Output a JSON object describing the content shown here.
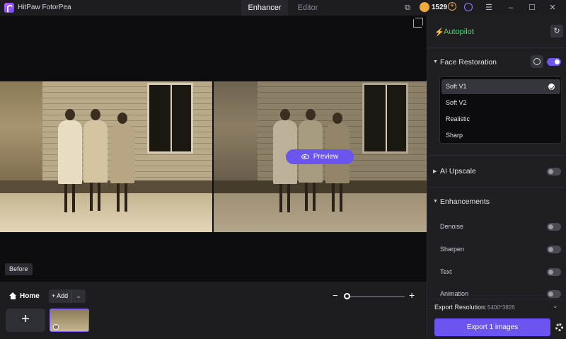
{
  "app": {
    "title": "HitPaw FotorPea"
  },
  "tabs": [
    {
      "label": "Enhancer",
      "active": true
    },
    {
      "label": "Editor",
      "active": false
    }
  ],
  "account": {
    "coins": "1529"
  },
  "canvas": {
    "before_label": "Before",
    "preview_label": "Preview"
  },
  "bottombar": {
    "home_label": "Home",
    "add_label": "+ Add",
    "add_tile_label": "+"
  },
  "panel": {
    "autopilot_label": "Autopilot",
    "face_restoration": {
      "title": "Face Restoration",
      "enabled": true,
      "models": [
        "Soft V1",
        "Soft V2",
        "Realistic",
        "Sharp"
      ],
      "selected": "Soft V1"
    },
    "ai_upscale": {
      "title": "AI Upscale",
      "enabled": false
    },
    "enhancements": {
      "title": "Enhancements",
      "items": [
        {
          "label": "Denoise",
          "enabled": false
        },
        {
          "label": "Sharpen",
          "enabled": false
        },
        {
          "label": "Text",
          "enabled": false
        },
        {
          "label": "Animation",
          "enabled": false
        }
      ]
    },
    "export_resolution_label": "Export Resolution:",
    "export_resolution_value": "5400*3826",
    "export_button": "Export 1 images"
  },
  "colors": {
    "accent": "#6a55ee",
    "autopilot": "#3ddc6b",
    "coin": "#f1a93b"
  }
}
